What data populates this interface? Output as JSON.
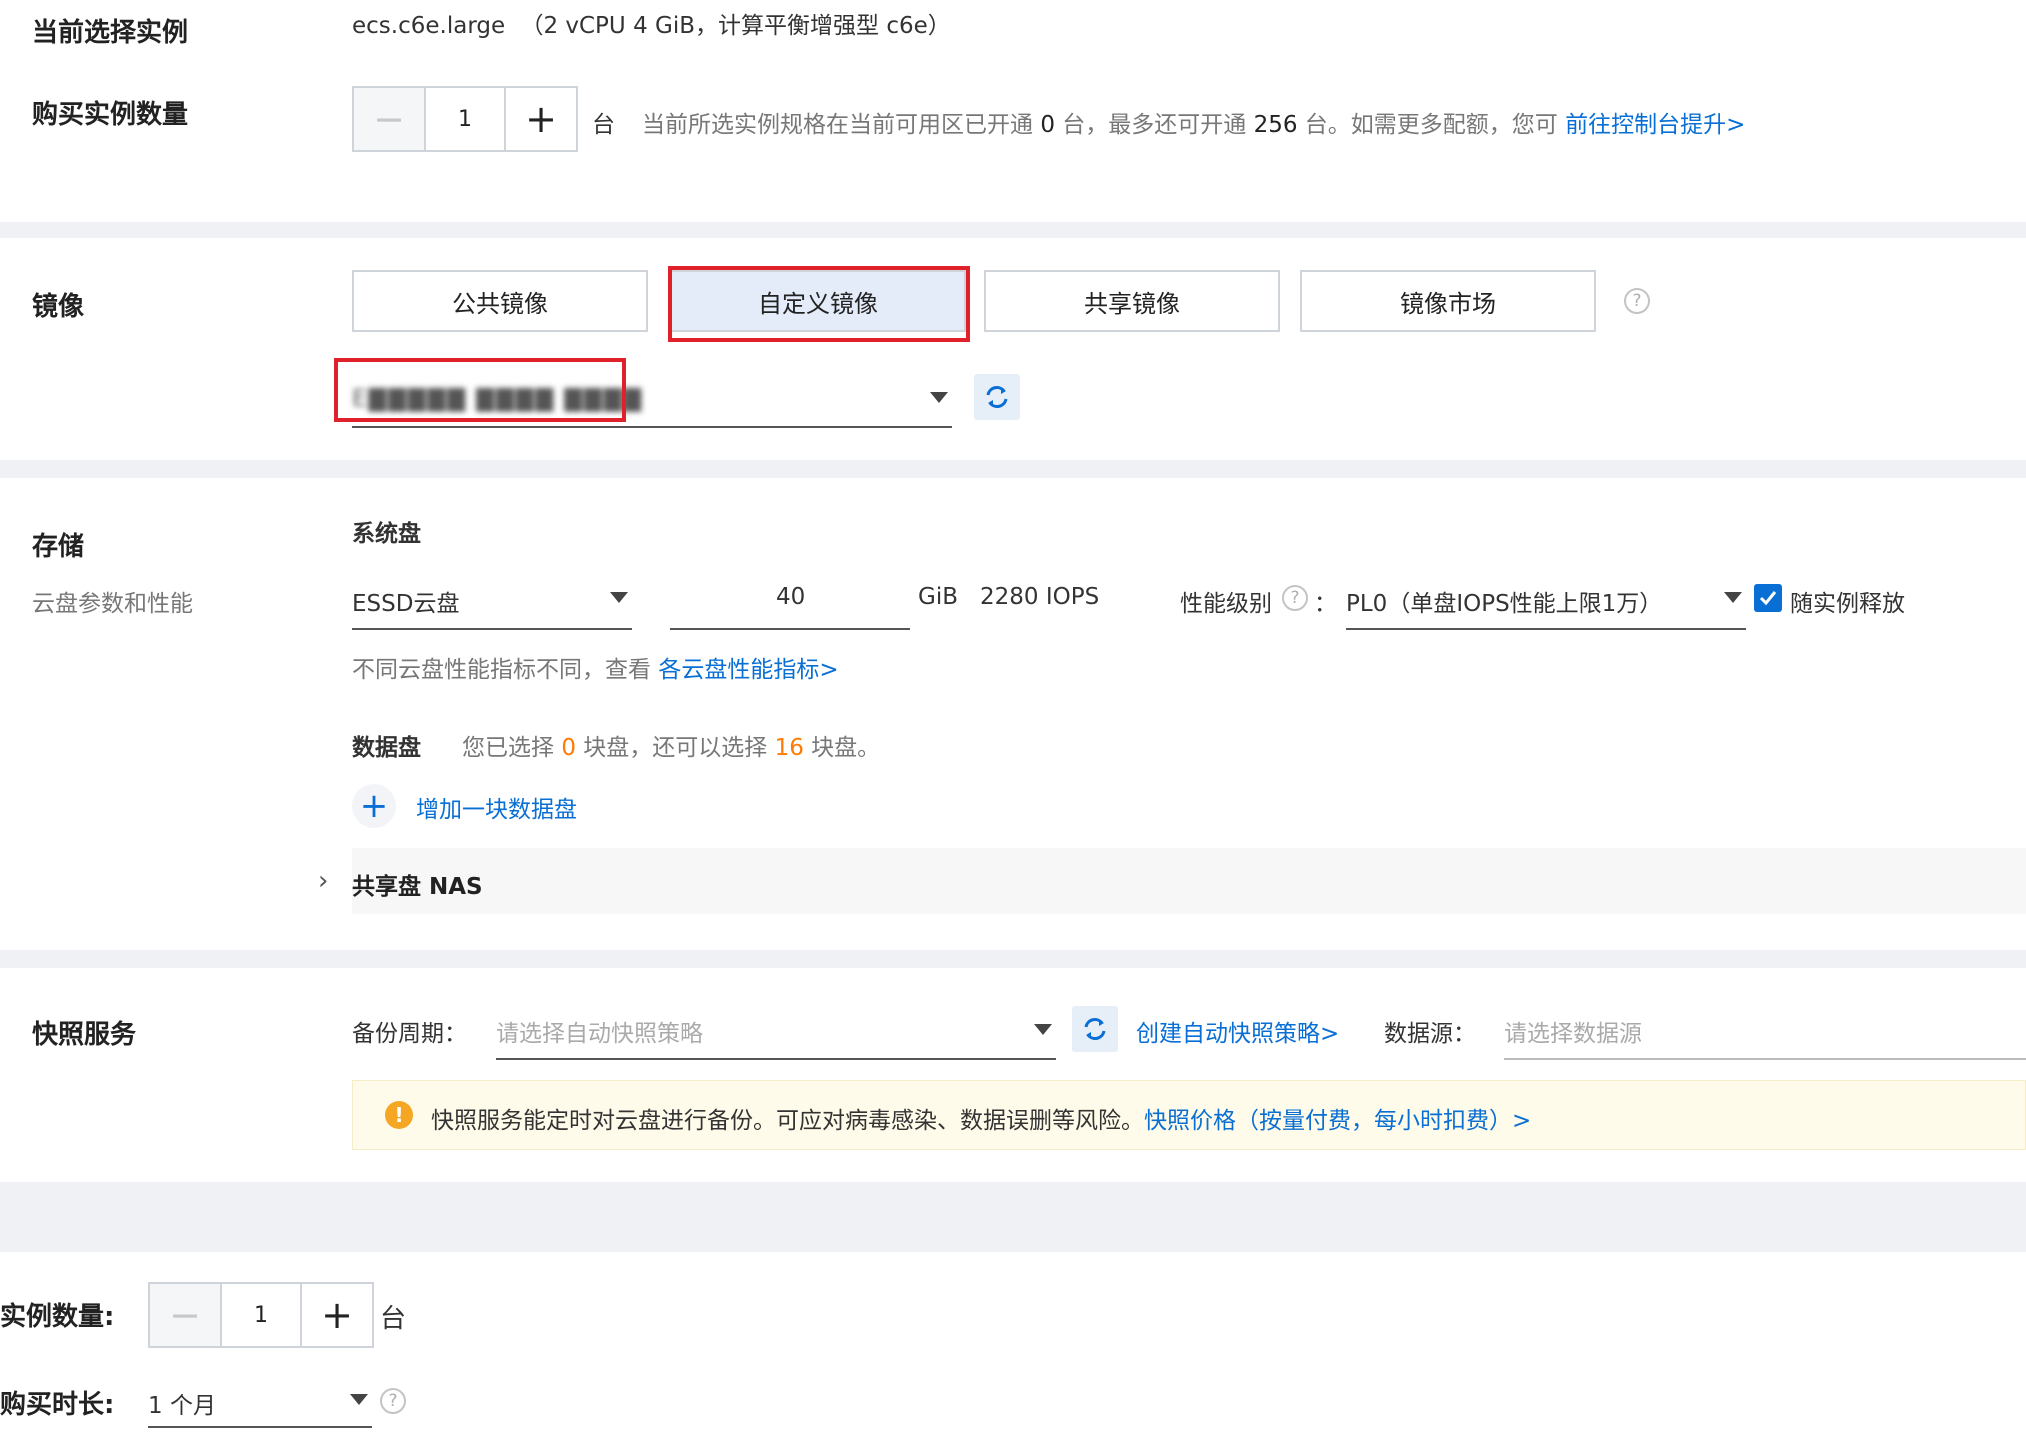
{
  "instance": {
    "label": "当前选择实例",
    "spec_name": "ecs.c6e.large",
    "spec_desc": "（2 vCPU 4 GiB，计算平衡增强型 c6e）"
  },
  "purchase_count": {
    "label": "购买实例数量",
    "value": "1",
    "unit": "台",
    "hint_a": "当前所选实例规格在当前可用区已开通",
    "hint_open": "0",
    "hint_b": "台，最多还可开通",
    "hint_max": "256",
    "hint_c": "台。如需更多配额，您可",
    "hint_link": "前往控制台提升>"
  },
  "image": {
    "label": "镜像",
    "tabs": [
      "公共镜像",
      "自定义镜像",
      "共享镜像",
      "镜像市场"
    ],
    "selected_value": "E▇▇▇▇▇ ▇▇▇▇ ▇▇▇▇"
  },
  "storage": {
    "label": "存储",
    "sublabel": "云盘参数和性能",
    "system_disk_title": "系统盘",
    "disk_type": "ESSD云盘",
    "size": "40",
    "size_unit": "GiB",
    "iops": "2280 IOPS",
    "perf_label": "性能级别",
    "perf_colon": "：",
    "perf_value": "PL0（单盘IOPS性能上限1万）",
    "release_label": "随实例释放",
    "perf_hint": "不同云盘性能指标不同，查看",
    "perf_link": "各云盘性能指标>",
    "data_disk_title": "数据盘",
    "data_hint_a": "您已选择",
    "data_selected": "0",
    "data_hint_b": "块盘，还可以选择",
    "data_remaining": "16",
    "data_hint_c": "块盘。",
    "add_disk": "增加一块数据盘",
    "nas_label": "共享盘 NAS"
  },
  "snapshot": {
    "label": "快照服务",
    "backup_label": "备份周期：",
    "backup_placeholder": "请选择自动快照策略",
    "create_link": "创建自动快照策略>",
    "source_label": "数据源：",
    "source_placeholder": "请选择数据源",
    "notice": "快照服务能定时对云盘进行备份。可应对病毒感染、数据误删等风险。",
    "notice_link": "快照价格（按量付费，每小时扣费）>"
  },
  "footer": {
    "count_label": "实例数量:",
    "count_value": "1",
    "count_unit": "台",
    "duration_label": "购买时长:",
    "duration_value": "1 个月"
  },
  "colors": {
    "accent": "#0a6fd4",
    "highlight_box": "#e0202a",
    "warning": "#f5a623"
  }
}
